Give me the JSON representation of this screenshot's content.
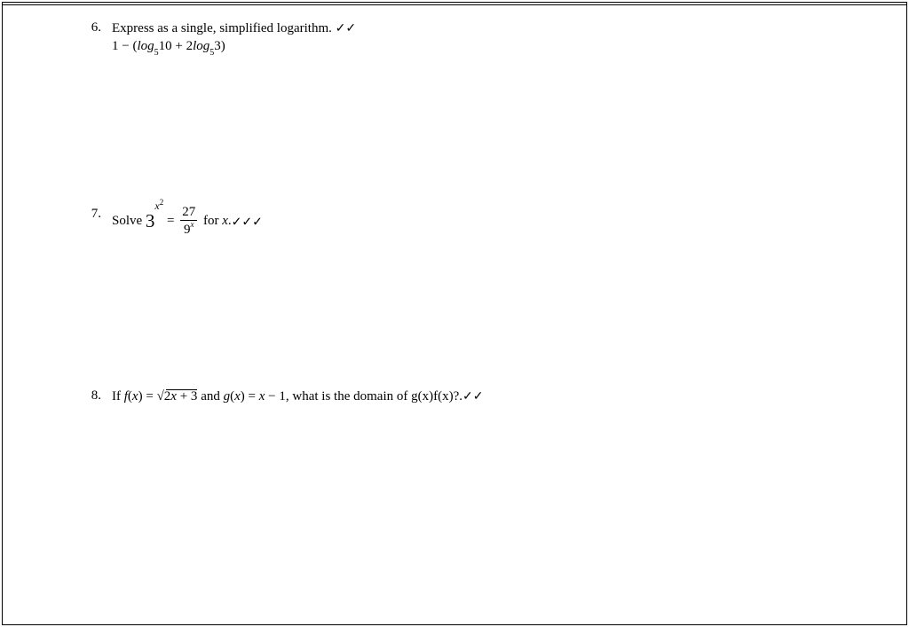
{
  "problems": {
    "p6": {
      "number": "6.",
      "prompt": "Express as a single, simplified logarithm.",
      "checks": "✓✓",
      "expr_prefix": "1 − (",
      "log1_base": "5",
      "log1_arg": "10 + 2",
      "log2_base": "5",
      "log2_arg": "3)",
      "log_word": "log"
    },
    "p7": {
      "number": "7.",
      "solve": "Solve ",
      "base": "3",
      "exp_x": "x",
      "exp_2": "2",
      "equals": " = ",
      "frac_top": "27",
      "frac_bot_base": "9",
      "frac_bot_exp": "x",
      "for_x": "  for ",
      "x": "x",
      "period": ".",
      "checks": "✓✓✓"
    },
    "p8": {
      "number": "8.",
      "if_text": "If ",
      "f_of_x": "f",
      "paren_x1": "(x) = ",
      "sqrt_arg": "2x + 3",
      "and_text": "  and ",
      "g_of_x": "g",
      "paren_x2": "(x) = ",
      "x_minus_1": "x − 1",
      "question": ", what is the domain of g(x)f(x)?.",
      "checks": "✓✓"
    }
  }
}
